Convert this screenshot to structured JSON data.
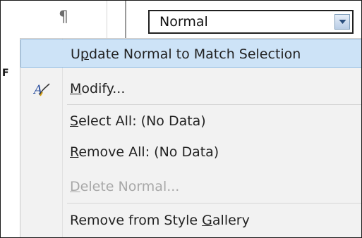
{
  "toolbar": {
    "paragraph_mark": "¶",
    "style_value": "Normal",
    "left_edge_text": "F"
  },
  "menu": {
    "update": {
      "pre": "U",
      "ul": "p",
      "post": "date Normal to Match Selection"
    },
    "modify": {
      "pre": "",
      "ul": "M",
      "post": "odify..."
    },
    "select_all": {
      "pre": "",
      "ul": "S",
      "post": "elect All: (No Data)"
    },
    "remove_all": {
      "pre": "",
      "ul": "R",
      "post": "emove All: (No Data)"
    },
    "delete": {
      "pre": "",
      "ul": "D",
      "post": "elete Normal..."
    },
    "remove_gallery": {
      "pre": "Remove from Style ",
      "ul": "G",
      "post": "allery"
    }
  },
  "colors": {
    "highlight_bg": "#cde3f7",
    "highlight_border": "#8fbce6",
    "menu_bg": "#f2f2f2",
    "disabled_text": "#a8a8a8"
  }
}
